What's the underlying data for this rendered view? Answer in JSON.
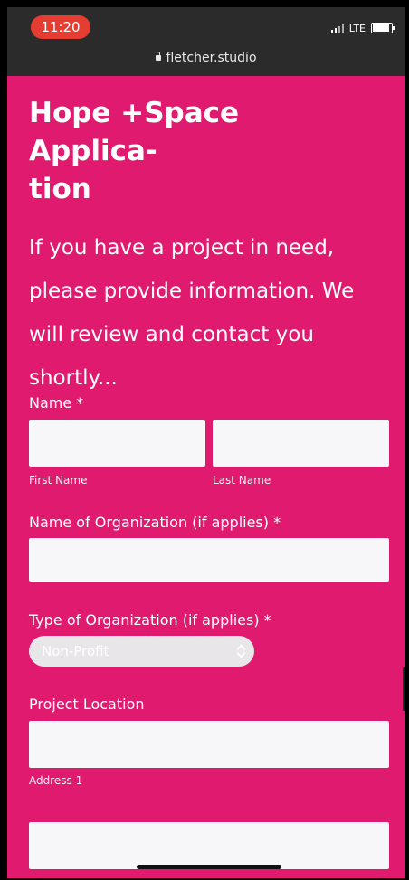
{
  "status": {
    "time": "11:20",
    "network": "LTE",
    "url": "fletcher.studio"
  },
  "page": {
    "title": "Hope +Space Applica-\ntion",
    "intro": "If you have a project in need, please provide information. We will review and contact you shortly..."
  },
  "form": {
    "name_label": "Name *",
    "first_name_sublabel": "First Name",
    "last_name_sublabel": "Last Name",
    "org_name_label": "Name of Organization (if applies) *",
    "org_type_label": "Type of Organization (if applies) *",
    "org_type_selected": "Non-Profit",
    "location_label": "Project Location",
    "address1_sublabel": "Address 1"
  },
  "colors": {
    "background": "#e01a6f",
    "statusbar": "#2b2b2b",
    "time_pill": "#e53d32"
  }
}
